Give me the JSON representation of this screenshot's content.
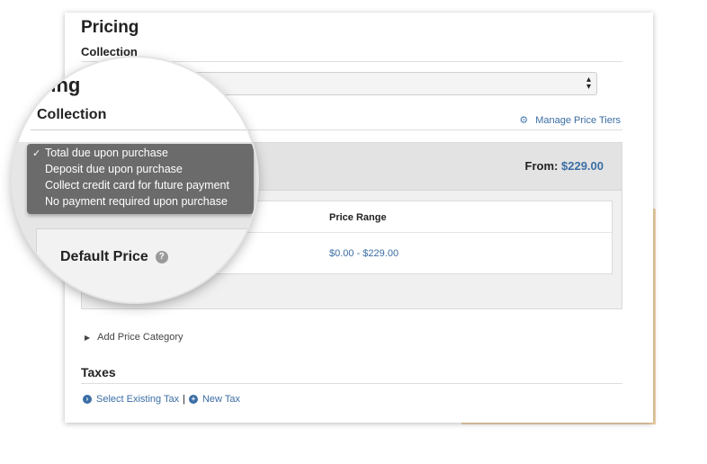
{
  "page": {
    "title": "Pricing",
    "collection_label": "Collection"
  },
  "manage_tiers": {
    "label": "Manage Price Tiers",
    "icon": "gear-icon"
  },
  "pricing_panel": {
    "from_label": "From:",
    "from_price": "$229.00",
    "table": {
      "header": "Price Range",
      "rows": [
        {
          "name": "Default Price",
          "range": "$0.00 - $229.00"
        }
      ]
    }
  },
  "add_price_category": "Add Price Category",
  "taxes": {
    "heading": "Taxes",
    "select_existing": "Select Existing Tax",
    "separator": "|",
    "new_tax": "New Tax"
  },
  "collection_dropdown": {
    "selected_index": 0,
    "options": [
      "Total due upon purchase",
      "Deposit due upon purchase",
      "Collect credit card for future payment",
      "No payment required upon purchase"
    ]
  },
  "magnifier": {
    "title_fragment": "icing",
    "collection_label": "Collection",
    "default_price_label": "Default Price"
  },
  "colors": {
    "link": "#3b6ea5",
    "accent_orange": "#f0d2a8",
    "dropdown_bg": "#6b6b6b"
  }
}
